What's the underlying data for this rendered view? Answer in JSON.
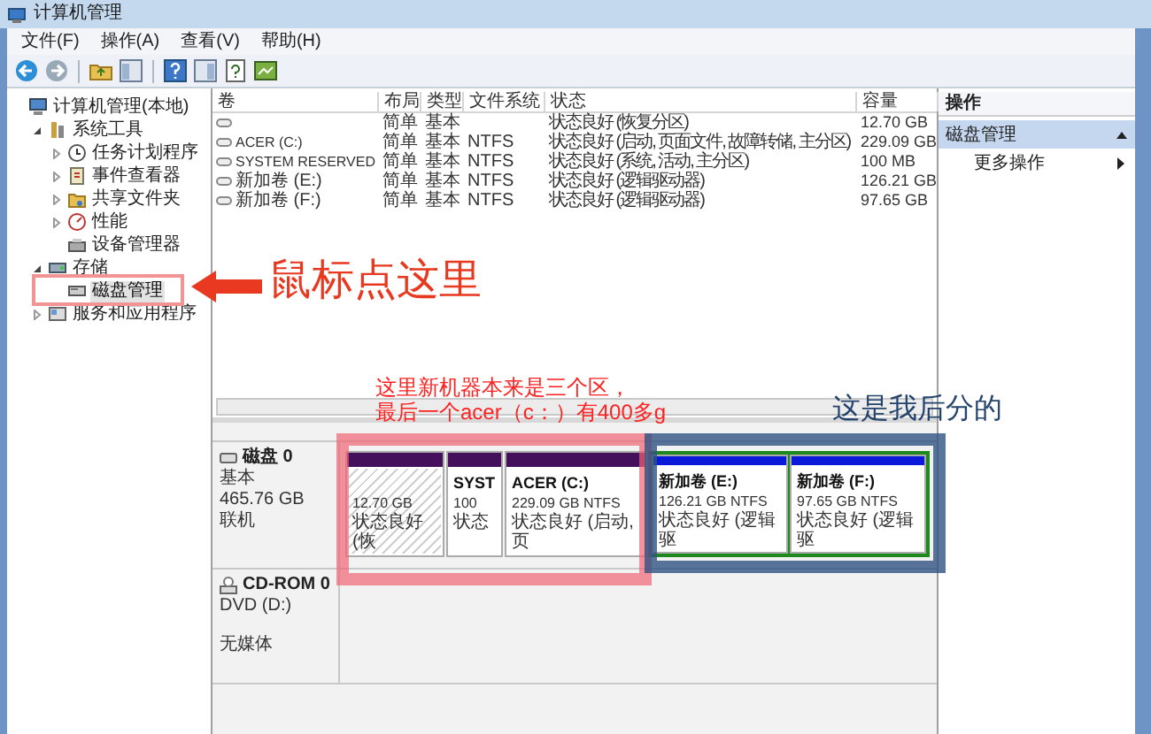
{
  "window": {
    "title": "计算机管理"
  },
  "menu": [
    "文件(F)",
    "操作(A)",
    "查看(V)",
    "帮助(H)"
  ],
  "tree": [
    {
      "label": "计算机管理(本地)",
      "selected": false,
      "children": [
        {
          "label": "系统工具",
          "expanded": true,
          "selected": false,
          "children": [
            {
              "label": "任务计划程序",
              "expanded": false,
              "selected": false
            },
            {
              "label": "事件查看器",
              "expanded": false,
              "selected": false
            },
            {
              "label": "共享文件夹",
              "expanded": false,
              "selected": false
            },
            {
              "label": "性能",
              "expanded": false,
              "selected": false
            },
            {
              "label": "设备管理器",
              "selected": false
            }
          ]
        },
        {
          "label": "存储",
          "expanded": true,
          "selected": false,
          "children": [
            {
              "label": "磁盘管理",
              "selected": true
            }
          ]
        },
        {
          "label": "服务和应用程序",
          "expanded": false,
          "selected": false
        }
      ]
    }
  ],
  "table": {
    "columns": [
      "卷",
      "布局",
      "类型",
      "文件系统",
      "状态",
      "容量"
    ],
    "rows": [
      {
        "layout": "简单",
        "type": "基本",
        "status": "状态良好 (恢复分区)",
        "capacity": "12.70 GB"
      },
      {
        "volume": "ACER (C:)",
        "layout": "简单",
        "type": "基本",
        "filesystem": "NTFS",
        "status": "状态良好 (启动, 页面文件, 故障转储, 主分区)",
        "capacity": "229.09 GB"
      },
      {
        "volume": "SYSTEM RESERVED",
        "layout": "简单",
        "type": "基本",
        "filesystem": "NTFS",
        "status": "状态良好 (系统, 活动, 主分区)",
        "capacity": "100 MB"
      },
      {
        "volume": "新加卷 (E:)",
        "layout": "简单",
        "type": "基本",
        "filesystem": "NTFS",
        "status": "状态良好 (逻辑驱动器)",
        "capacity": "126.21 GB"
      },
      {
        "volume": "新加卷 (F:)",
        "layout": "简单",
        "type": "基本",
        "filesystem": "NTFS",
        "status": "状态良好 (逻辑驱动器)",
        "capacity": "97.65 GB"
      }
    ]
  },
  "disks": [
    {
      "kind": "hdd",
      "name": "磁盘 0",
      "lines": [
        "基本",
        "465.76 GB",
        "联机"
      ],
      "partitions": [
        {
          "kind": "primary",
          "hatched": true,
          "size": "12.70 GB",
          "status": "状态良好 (恢"
        },
        {
          "kind": "primary",
          "hatched": false,
          "name": "SYST",
          "size": "100",
          "status": "状态"
        },
        {
          "kind": "primary",
          "hatched": false,
          "name": "ACER (C:)",
          "size": "229.09 GB NTFS",
          "status": "状态良好 (启动, 页"
        },
        {
          "kind": "logical",
          "hatched": false,
          "name": "新加卷 (E:)",
          "size": "126.21 GB NTFS",
          "status": "状态良好 (逻辑驱"
        },
        {
          "kind": "logical",
          "hatched": false,
          "name": "新加卷 (F:)",
          "size": "97.65 GB NTFS",
          "status": "状态良好 (逻辑驱"
        }
      ]
    },
    {
      "kind": "cdrom",
      "name": "CD-ROM 0",
      "lines": [
        "DVD (D:)",
        "无媒体"
      ]
    }
  ],
  "actions": {
    "header": "操作",
    "section": "磁盘管理",
    "expanded": true,
    "items": [
      "更多操作"
    ]
  },
  "annotations": {
    "arrow_label": "鼠标点这里",
    "note_lines": [
      "这里新机器本来是三个区，",
      "最后一个acer（c：）有400多g"
    ],
    "note_right": "这是我后分的"
  }
}
